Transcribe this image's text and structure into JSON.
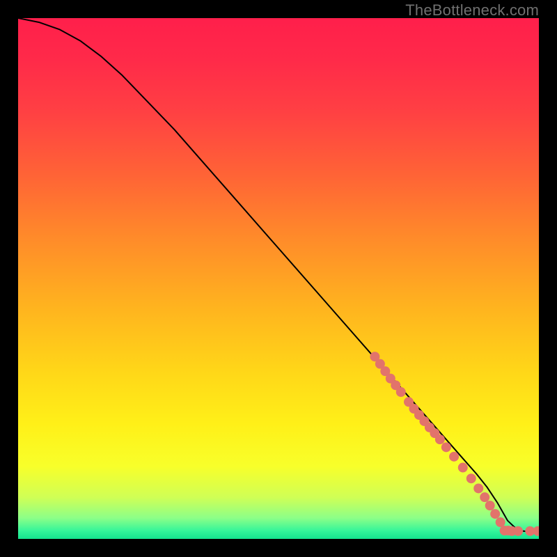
{
  "watermark": "TheBottleneck.com",
  "chart_data": {
    "type": "line",
    "title": "",
    "xlabel": "",
    "ylabel": "",
    "xlim": [
      0,
      100
    ],
    "ylim": [
      0,
      100
    ],
    "grid": false,
    "legend": false,
    "background_gradient": {
      "stops": [
        {
          "offset": 0.0,
          "color": "#ff1f4b"
        },
        {
          "offset": 0.08,
          "color": "#ff2a49"
        },
        {
          "offset": 0.18,
          "color": "#ff4043"
        },
        {
          "offset": 0.3,
          "color": "#ff6336"
        },
        {
          "offset": 0.42,
          "color": "#ff8a2a"
        },
        {
          "offset": 0.55,
          "color": "#ffb21f"
        },
        {
          "offset": 0.68,
          "color": "#ffd718"
        },
        {
          "offset": 0.78,
          "color": "#fff018"
        },
        {
          "offset": 0.86,
          "color": "#f8ff2a"
        },
        {
          "offset": 0.92,
          "color": "#d0ff55"
        },
        {
          "offset": 0.96,
          "color": "#8cff88"
        },
        {
          "offset": 0.985,
          "color": "#33f59a"
        },
        {
          "offset": 1.0,
          "color": "#14e38f"
        }
      ]
    },
    "series": [
      {
        "name": "curve",
        "stroke": "#000000",
        "stroke_width": 2,
        "x": [
          0,
          4,
          8,
          12,
          16,
          20,
          30,
          40,
          50,
          60,
          70,
          80,
          85,
          88,
          90,
          92,
          94,
          96,
          98,
          100
        ],
        "y": [
          100,
          99.2,
          97.8,
          95.6,
          92.6,
          89.0,
          78.6,
          67.2,
          55.8,
          44.4,
          33.0,
          21.6,
          15.9,
          12.5,
          10.0,
          7.0,
          3.5,
          1.6,
          1.4,
          1.4
        ]
      }
    ],
    "markers": {
      "name": "dots",
      "color": "#e2736b",
      "radius": 7,
      "points": [
        {
          "x": 68.5,
          "y": 35.0
        },
        {
          "x": 69.5,
          "y": 33.6
        },
        {
          "x": 70.5,
          "y": 32.2
        },
        {
          "x": 71.5,
          "y": 30.8
        },
        {
          "x": 72.5,
          "y": 29.5
        },
        {
          "x": 73.5,
          "y": 28.2
        },
        {
          "x": 75.0,
          "y": 26.3
        },
        {
          "x": 76.0,
          "y": 25.0
        },
        {
          "x": 77.0,
          "y": 23.8
        },
        {
          "x": 78.0,
          "y": 22.6
        },
        {
          "x": 79.0,
          "y": 21.4
        },
        {
          "x": 80.0,
          "y": 20.3
        },
        {
          "x": 81.0,
          "y": 19.1
        },
        {
          "x": 82.2,
          "y": 17.6
        },
        {
          "x": 83.7,
          "y": 15.8
        },
        {
          "x": 85.4,
          "y": 13.7
        },
        {
          "x": 87.0,
          "y": 11.6
        },
        {
          "x": 88.4,
          "y": 9.7
        },
        {
          "x": 89.6,
          "y": 8.0
        },
        {
          "x": 90.6,
          "y": 6.4
        },
        {
          "x": 91.6,
          "y": 4.8
        },
        {
          "x": 92.6,
          "y": 3.2
        },
        {
          "x": 93.4,
          "y": 1.6
        },
        {
          "x": 94.1,
          "y": 1.6
        },
        {
          "x": 94.8,
          "y": 1.5
        },
        {
          "x": 96.0,
          "y": 1.5
        },
        {
          "x": 98.3,
          "y": 1.5
        },
        {
          "x": 99.8,
          "y": 1.5
        }
      ]
    }
  }
}
